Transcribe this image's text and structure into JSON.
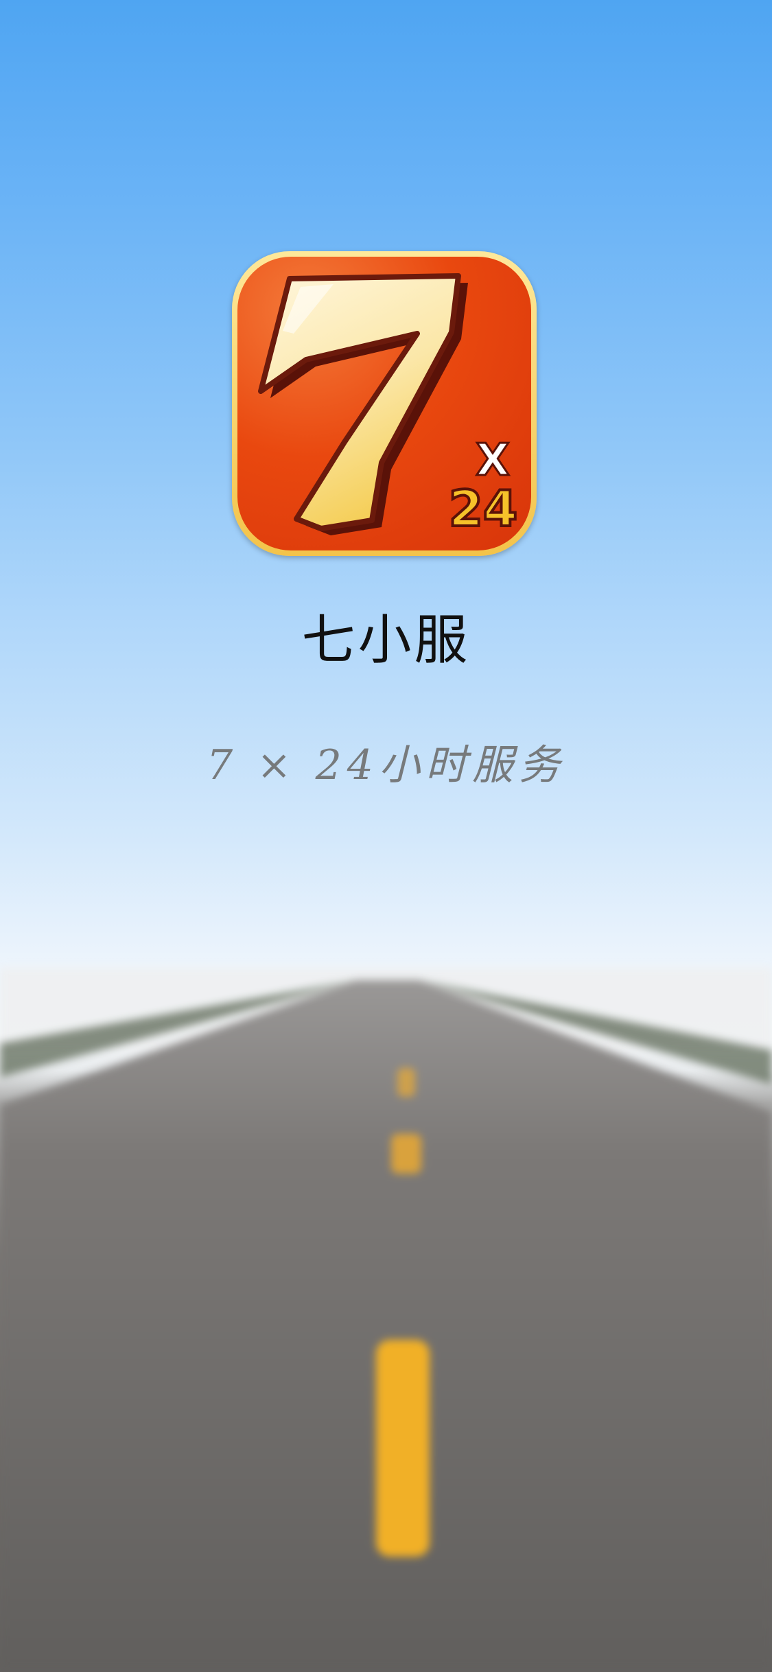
{
  "app": {
    "name": "七小服",
    "tagline": "7 × 24小时服务"
  },
  "logo": {
    "main_digit": "7",
    "badge_x": "X",
    "badge_num": "24",
    "colors": {
      "border": "#f5cc52",
      "background": "#e9480f",
      "digit": "#fbefc6",
      "badge_text": "#f6c22a"
    }
  },
  "background": {
    "sky_top": "#4fa5f2",
    "sky_bottom": "#eef5fc",
    "road": "#6c6966",
    "lane_marking": "#f1b027"
  }
}
